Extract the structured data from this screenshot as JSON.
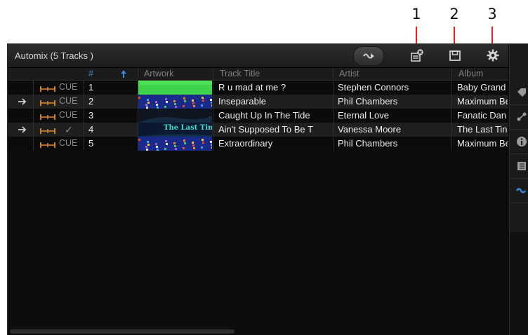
{
  "callouts": [
    "1",
    "2",
    "3"
  ],
  "header": {
    "title": "Automix (5 Tracks )",
    "automix_icon": "automix-play-icon",
    "icons": [
      "remove-from-playlist-icon",
      "save-icon",
      "settings-gear-icon"
    ]
  },
  "columns": {
    "number": "#",
    "artwork": "Artwork",
    "track_title": "Track Title",
    "artist": "Artist",
    "album": "Album"
  },
  "tracks": [
    {
      "playing": false,
      "status": "CUE",
      "num": "1",
      "title": "R u mad at me ?",
      "artist": "Stephen Connors",
      "album": "Baby Grand",
      "art": "green"
    },
    {
      "playing": true,
      "status": "CUE",
      "num": "2",
      "title": "Inseparable",
      "artist": "Phil Chambers",
      "album": "Maximum Be",
      "art": "crowd"
    },
    {
      "playing": false,
      "status": "CUE",
      "num": "3",
      "title": "Caught Up In The Tide",
      "artist": "Eternal Love",
      "album": "Fanatic Dan",
      "art": "dark"
    },
    {
      "playing": true,
      "status": "✓",
      "num": "4",
      "title": "Ain't Supposed To Be T",
      "artist": "Vanessa Moore",
      "album": "The Last Tin",
      "art": "lasttime"
    },
    {
      "playing": false,
      "status": "CUE",
      "num": "5",
      "title": "Extraordinary",
      "artist": "Phil Chambers",
      "album": "Maximum Be",
      "art": "crowd"
    }
  ],
  "artwork_text": {
    "lasttime": "The Last Time"
  },
  "sidebar": [
    "tag-icon",
    "related-tracks-icon",
    "info-icon",
    "list-icon",
    "automix-icon"
  ],
  "colors": {
    "accent_orange": "#e38a2c",
    "sort_arrow_blue": "#3b86d6",
    "callout_red": "#e8201f"
  }
}
